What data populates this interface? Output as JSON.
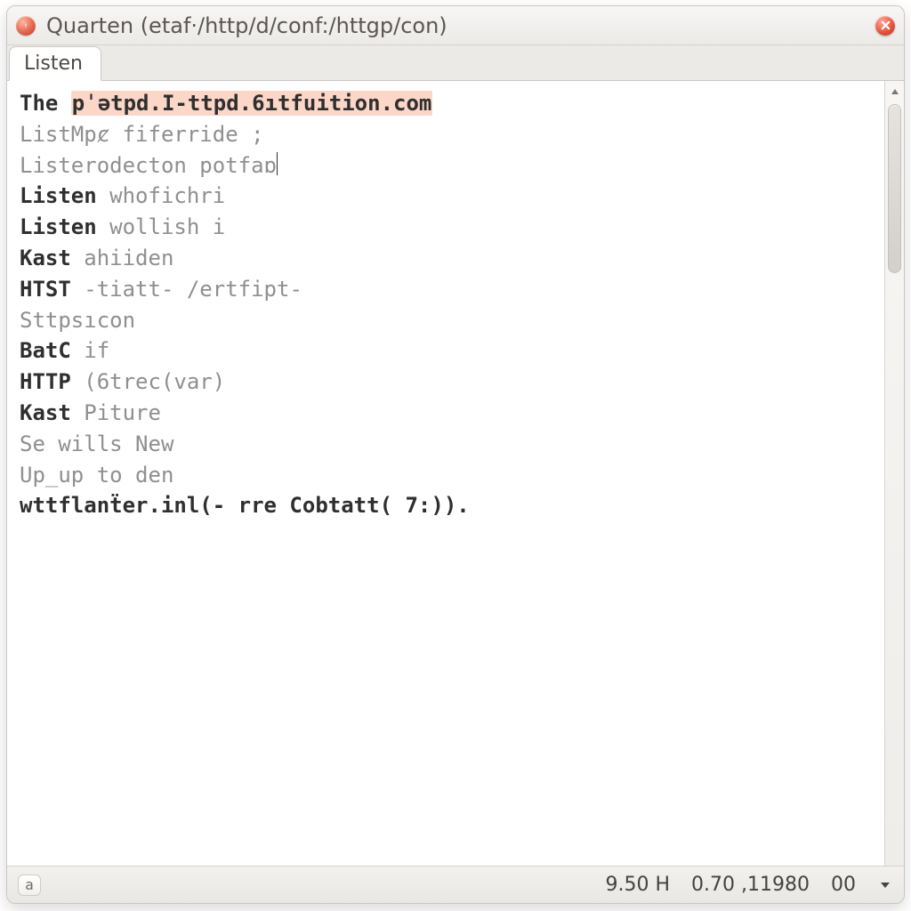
{
  "window": {
    "title": "Quarten (etaf·/http/d/conf:/httgp/con)"
  },
  "tabs": [
    {
      "label": "Listen"
    }
  ],
  "editor": {
    "lines": [
      {
        "kw": "The ",
        "hl": "pˈətpd.I-ttpd.6ıtfuition.com",
        "rest": ""
      },
      {
        "dimPrefix": "ListMpȼ fiferride ;",
        "rest": ""
      },
      {
        "dimPrefix": "Listerodecton potfaɒ",
        "rest": "",
        "caretAfter": true
      },
      {
        "kw": "Listen ",
        "dim": "whofichri"
      },
      {
        "kw": "Listen ",
        "dim": "wollish i"
      },
      {
        "kw": "Kast ",
        "dim": "ahiiden"
      },
      {
        "kw": "HTST ",
        "dim": "-tiatt- /ertfipt-"
      },
      {
        "dimPrefix": "Sttpsıcon"
      },
      {
        "kw": "BatC ",
        "dim": "if"
      },
      {
        "kw": "HTTP ",
        "dim": "(6trec(var)"
      },
      {
        "kw": "Kast ",
        "dim": "Piture"
      },
      {
        "dimPrefix": "Se wills New"
      },
      {
        "dimPrefix": "Up_up to den"
      },
      {
        "kw": "wttflanẗer.inl(- rre Cobtatt( 7:))."
      }
    ]
  },
  "statusbar": {
    "leftBtn": "a",
    "field1": "9.50 H",
    "field2": "0.70 ,11980",
    "field3": "00"
  }
}
